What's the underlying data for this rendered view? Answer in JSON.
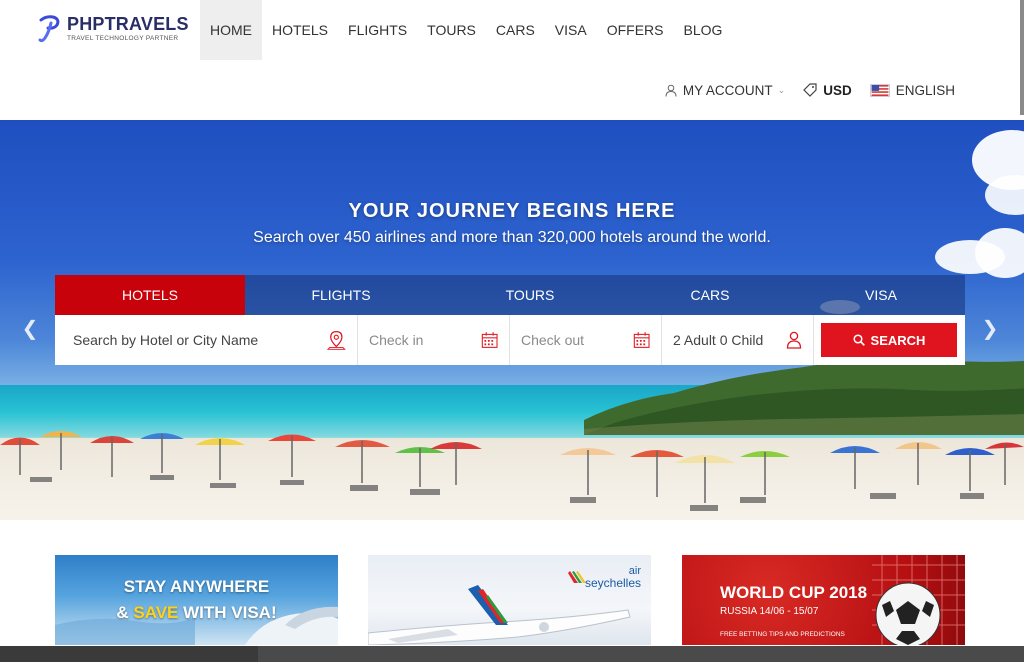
{
  "brand": {
    "name": "PHPTRAVELS",
    "tagline": "TRAVEL TECHNOLOGY PARTNER",
    "color": "#2a2e66"
  },
  "nav": {
    "items": [
      {
        "label": "HOME",
        "active": true
      },
      {
        "label": "HOTELS"
      },
      {
        "label": "FLIGHTS"
      },
      {
        "label": "TOURS"
      },
      {
        "label": "CARS"
      },
      {
        "label": "VISA"
      },
      {
        "label": "OFFERS"
      },
      {
        "label": "BLOG"
      }
    ]
  },
  "utilities": {
    "account": "MY ACCOUNT",
    "currency": "USD",
    "language": "ENGLISH"
  },
  "hero": {
    "title": "YOUR JOURNEY BEGINS HERE",
    "subtitle": "Search over 450 airlines and more than 320,000 hotels around the world.",
    "prev_icon": "chevron-left-icon",
    "next_icon": "chevron-right-icon"
  },
  "search": {
    "tabs": [
      {
        "label": "HOTELS",
        "active": true
      },
      {
        "label": "FLIGHTS"
      },
      {
        "label": "TOURS"
      },
      {
        "label": "CARS"
      },
      {
        "label": "VISA"
      }
    ],
    "hotel_placeholder": "Search by Hotel or City Name",
    "checkin_placeholder": "Check in",
    "checkout_placeholder": "Check out",
    "guests": "2 Adult 0 Child",
    "button": "SEARCH",
    "accent": "#e0141e"
  },
  "promos": {
    "visa": {
      "line1": "STAY ANYWHERE",
      "line2_a": "& ",
      "line2_b": "SAVE",
      "line2_c": " WITH VISA!"
    },
    "airline": {
      "line1": "air",
      "line2": "seychelles"
    },
    "worldcup": {
      "title": "WORLD CUP 2018",
      "subtitle": "RUSSIA 14/06 - 15/07",
      "small": "FREE BETTING TIPS AND PREDICTIONS"
    }
  }
}
